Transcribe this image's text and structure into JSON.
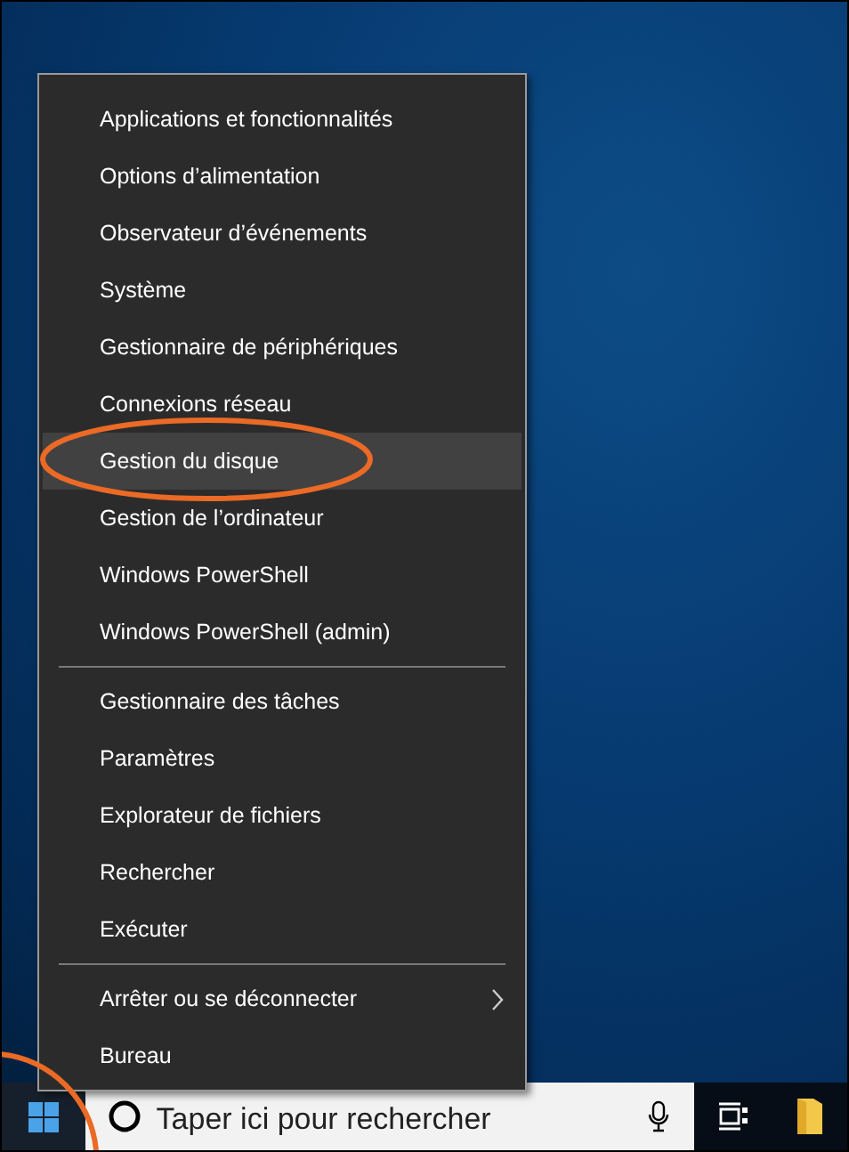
{
  "menu": {
    "groups": [
      {
        "items": [
          {
            "label": "Applications et fonctionnalités",
            "selected": false,
            "has_submenu": false
          },
          {
            "label": "Options d’alimentation",
            "selected": false,
            "has_submenu": false
          },
          {
            "label": "Observateur d’événements",
            "selected": false,
            "has_submenu": false
          },
          {
            "label": "Système",
            "selected": false,
            "has_submenu": false
          },
          {
            "label": "Gestionnaire de périphériques",
            "selected": false,
            "has_submenu": false
          },
          {
            "label": "Connexions réseau",
            "selected": false,
            "has_submenu": false
          },
          {
            "label": "Gestion du disque",
            "selected": true,
            "has_submenu": false
          },
          {
            "label": "Gestion de l’ordinateur",
            "selected": false,
            "has_submenu": false
          },
          {
            "label": "Windows PowerShell",
            "selected": false,
            "has_submenu": false
          },
          {
            "label": "Windows PowerShell (admin)",
            "selected": false,
            "has_submenu": false
          }
        ]
      },
      {
        "items": [
          {
            "label": "Gestionnaire des tâches",
            "selected": false,
            "has_submenu": false
          },
          {
            "label": "Paramètres",
            "selected": false,
            "has_submenu": false
          },
          {
            "label": "Explorateur de fichiers",
            "selected": false,
            "has_submenu": false
          },
          {
            "label": "Rechercher",
            "selected": false,
            "has_submenu": false
          },
          {
            "label": "Exécuter",
            "selected": false,
            "has_submenu": false
          }
        ]
      },
      {
        "items": [
          {
            "label": "Arrêter ou se déconnecter",
            "selected": false,
            "has_submenu": true
          },
          {
            "label": "Bureau",
            "selected": false,
            "has_submenu": false
          }
        ]
      }
    ]
  },
  "taskbar": {
    "search": {
      "placeholder": "Taper ici pour rechercher"
    }
  }
}
